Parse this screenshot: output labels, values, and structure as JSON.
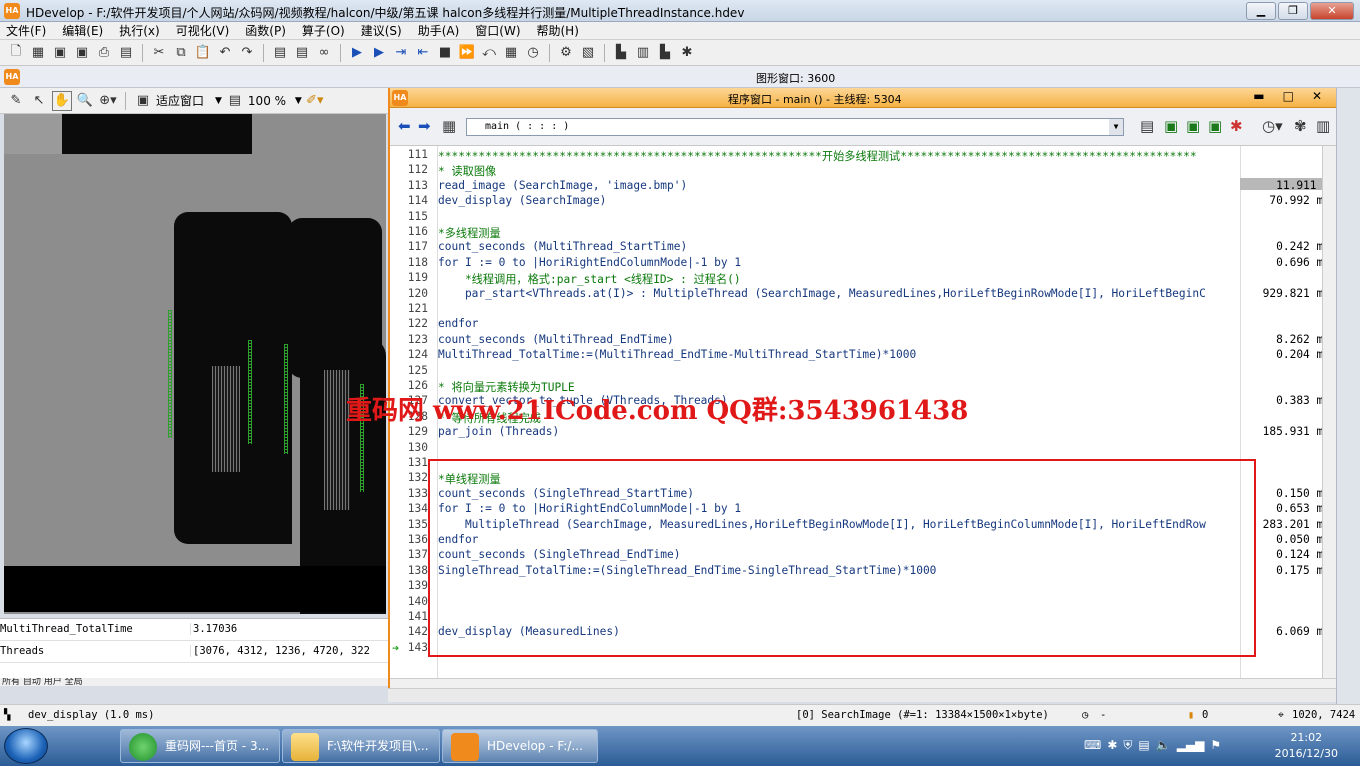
{
  "window": {
    "title": "HDevelop - F:/软件开发项目/个人网站/众码网/视频教程/halcon/中级/第五课  halcon多线程并行测量/MultipleThreadInstance.hdev",
    "app_badge": "HA",
    "min_icon": "minimize-icon",
    "max_icon": "restore-icon",
    "close_icon": "close-icon"
  },
  "menu": [
    "文件(F)",
    "编辑(E)",
    "执行(x)",
    "可视化(V)",
    "函数(P)",
    "算子(O)",
    "建议(S)",
    "助手(A)",
    "窗口(W)",
    "帮助(H)"
  ],
  "toolbar_icons": [
    "new-file-icon",
    "open-icon",
    "save-icon",
    "save-all-icon",
    "print-icon",
    "export-icon",
    "cut-icon",
    "copy-icon",
    "paste-icon",
    "undo-icon",
    "redo-icon",
    "insert-icon",
    "insert-program-icon",
    "bind-icon",
    "run-icon",
    "step-icon",
    "step-over-icon",
    "step-back-icon",
    "stop-icon",
    "continue-icon",
    "reset-icon",
    "inspect-icon",
    "timer-icon",
    "settings-icon",
    "graph-icon",
    "histogram-icon",
    "measure-icon",
    "gray-histogram-icon",
    "feature-icon"
  ],
  "graphics_window": {
    "label": "图形窗口: 3600",
    "fit_label": "适应窗口",
    "zoom_label": "100 %"
  },
  "variables": [
    {
      "name": "MultiThread_TotalTime",
      "value": "3.17036"
    },
    {
      "name": "Threads",
      "value": "[3076, 4312, 1236, 4720, 322"
    }
  ],
  "var_tabs": "所有  自动  用户  全局",
  "program_window": {
    "title": "程序窗口 - main () - 主线程: 5304",
    "procedure": "main ( : : : )",
    "lines": [
      {
        "n": "111",
        "text": "*********************************************************开始多线程测试********************************************",
        "cls": "cmt",
        "time": ""
      },
      {
        "n": "112",
        "text": "* 读取图像",
        "cls": "cmt",
        "time": ""
      },
      {
        "n": "113",
        "text": "read_image (SearchImage, 'image.bmp')",
        "cls": "ctl",
        "time": "11.911 s"
      },
      {
        "n": "114",
        "text": "dev_display (SearchImage)",
        "cls": "ctl",
        "time": "70.992 ms"
      },
      {
        "n": "115",
        "text": "",
        "cls": "ctl",
        "time": ""
      },
      {
        "n": "116",
        "text": "*多线程测量",
        "cls": "cmt",
        "time": ""
      },
      {
        "n": "117",
        "text": "count_seconds (MultiThread_StartTime)",
        "cls": "ctl",
        "time": "0.242 ms"
      },
      {
        "n": "118",
        "text": "for I := 0 to |HoriRightEndColumnMode|-1 by 1",
        "cls": "ctl",
        "time": "0.696 ms"
      },
      {
        "n": "119",
        "text": "    *线程调用，格式:par_start <线程ID> : 过程名()",
        "cls": "cmt",
        "time": ""
      },
      {
        "n": "120",
        "text": "    par_start<VThreads.at(I)> : MultipleThread (SearchImage, MeasuredLines,HoriLeftBeginRowMode[I], HoriLeftBeginC",
        "cls": "ctl",
        "time": "929.821 ms"
      },
      {
        "n": "121",
        "text": "",
        "cls": "ctl",
        "time": ""
      },
      {
        "n": "122",
        "text": "endfor",
        "cls": "ctl",
        "time": "-"
      },
      {
        "n": "123",
        "text": "count_seconds (MultiThread_EndTime)",
        "cls": "ctl",
        "time": "8.262 ms"
      },
      {
        "n": "124",
        "text": "MultiThread_TotalTime:=(MultiThread_EndTime-MultiThread_StartTime)*1000",
        "cls": "ctl",
        "time": "0.204 ms"
      },
      {
        "n": "125",
        "text": "",
        "cls": "ctl",
        "time": ""
      },
      {
        "n": "126",
        "text": "* 将向量元素转换为TUPLE",
        "cls": "cmt",
        "time": ""
      },
      {
        "n": "127",
        "text": "convert_vector_to_tuple (VThreads, Threads)",
        "cls": "ctl",
        "time": "0.383 ms"
      },
      {
        "n": "128",
        "text": "* 等待所有线程完成",
        "cls": "cmt",
        "time": ""
      },
      {
        "n": "129",
        "text": "par_join (Threads)",
        "cls": "ctl",
        "time": "185.931 ms"
      },
      {
        "n": "130",
        "text": "",
        "cls": "ctl",
        "time": ""
      },
      {
        "n": "131",
        "text": "",
        "cls": "ctl",
        "time": ""
      },
      {
        "n": "132",
        "text": "*单线程测量",
        "cls": "cmt",
        "time": ""
      },
      {
        "n": "133",
        "text": "count_seconds (SingleThread_StartTime)",
        "cls": "ctl",
        "time": "0.150 ms"
      },
      {
        "n": "134",
        "text": "for I := 0 to |HoriRightEndColumnMode|-1 by 1",
        "cls": "ctl",
        "time": "0.653 ms"
      },
      {
        "n": "135",
        "text": "    MultipleThread (SearchImage, MeasuredLines,HoriLeftBeginRowMode[I], HoriLeftBeginColumnMode[I], HoriLeftEndRow",
        "cls": "ctl",
        "time": "283.201 ms"
      },
      {
        "n": "136",
        "text": "endfor",
        "cls": "ctl",
        "time": "0.050 ms"
      },
      {
        "n": "137",
        "text": "count_seconds (SingleThread_EndTime)",
        "cls": "ctl",
        "time": "0.124 ms"
      },
      {
        "n": "138",
        "text": "SingleThread_TotalTime:=(SingleThread_EndTime-SingleThread_StartTime)*1000",
        "cls": "ctl",
        "time": "0.175 ms"
      },
      {
        "n": "139",
        "text": "",
        "cls": "ctl",
        "time": ""
      },
      {
        "n": "140",
        "text": "",
        "cls": "ctl",
        "time": ""
      },
      {
        "n": "141",
        "text": "",
        "cls": "ctl",
        "time": ""
      },
      {
        "n": "142",
        "text": "dev_display (MeasuredLines)",
        "cls": "ctl",
        "time": "6.069 ms"
      },
      {
        "n": "143",
        "text": "",
        "cls": "ctl",
        "time": ""
      }
    ]
  },
  "watermark": "重码网 www.21ICode.com  QQ群:3543961438",
  "status": {
    "operator": "dev_display (1.0 ms)",
    "image_info": "[0] SearchImage (#=1: 13384×1500×1×byte)",
    "timer": "-",
    "counter": "0",
    "coords": "1020,  7424"
  },
  "taskbar": {
    "items": [
      "重码网---首页 - 3...",
      "F:\\软件开发项目\\...",
      "HDevelop - F:/..."
    ],
    "time": "21:02",
    "date": "2016/12/30"
  },
  "colors": {
    "accent": "#f08a1c",
    "highlight_box": "#e01818",
    "comment": "#0b7a0b",
    "code": "#16387e"
  }
}
